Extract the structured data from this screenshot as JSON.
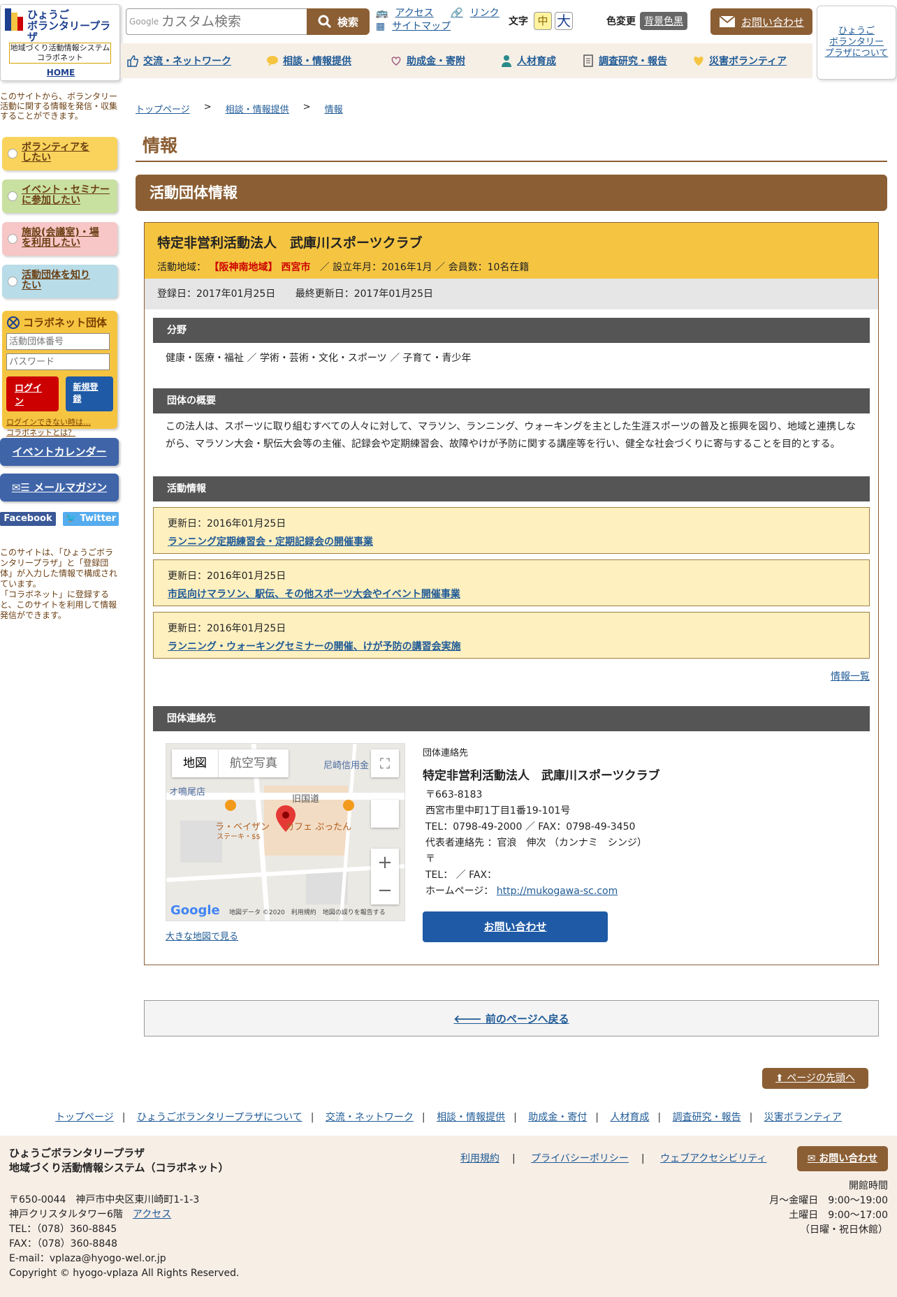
{
  "header": {
    "logo_title": "ひょうご\nボランタリープラザ",
    "logo_sub": "地域づくり活動情報システム\nコラボネット",
    "logo_home": "HOME",
    "search_google": "Google",
    "search_placeholder": "カスタム検索",
    "search_button": "検索",
    "link_access": "アクセス",
    "link_link": "リンク",
    "link_sitemap": "サイトマップ",
    "font_label": "文字",
    "font_mid": "中",
    "font_big": "大",
    "color_label": "色変更",
    "color_button": "背景色黒",
    "contact": "お問い合わせ",
    "about": "ひょうご\nボランタリー\nプラザについて"
  },
  "nav": [
    {
      "label": "交流・ネットワーク"
    },
    {
      "label": "相談・情報提供"
    },
    {
      "label": "助成金・寄附"
    },
    {
      "label": "人材育成"
    },
    {
      "label": "調査研究・報告"
    },
    {
      "label": "災害ボランティア"
    }
  ],
  "sidebar": {
    "intro": "このサイトから、ボランタリー活動に関する情報を発信・収集することができます。",
    "buttons": [
      {
        "label": "ボランティアを\nしたい",
        "color": "#f9d35c"
      },
      {
        "label": "イベント・セミナー\nに参加したい",
        "color": "#c8e0a0"
      },
      {
        "label": "施設(会議室)・場\nを利用したい",
        "color": "#f7c6c6"
      },
      {
        "label": "活動団体を知り\nたい",
        "color": "#b8dce8"
      }
    ],
    "login_title": "コラボネット団体",
    "login_id_placeholder": "活動団体番号",
    "login_pw_placeholder": "パスワード",
    "login_button": "ログイン",
    "register_button": "新規登録",
    "login_help1": "ログインできない時は…",
    "login_help2": "コラボネットとは？",
    "event_calendar": "イベントカレンダー",
    "mail_magazine": "メールマガジン",
    "facebook": "Facebook",
    "twitter": "Twitter",
    "note": "このサイトは、「ひょうごボランタリープラザ」と「登録団体」が入力した情報で構成されています。\n「コラボネット」に登録すると、このサイトを利用して情報発信ができます。"
  },
  "breadcrumb": [
    "トップページ",
    "相談・情報提供",
    "情報"
  ],
  "breadcrumb_sep": ">",
  "page_title": "情報",
  "section_title": "活動団体情報",
  "org": {
    "name": "特定非営利活動法人　武庫川スポーツクラブ",
    "area_label": "活動地域：",
    "area": "【阪神南地域】 西宮市",
    "meta": "／ 設立年月：2016年1月 ／ 会員数：10名在籍",
    "registered": "登録日：2017年01月25日",
    "updated": "最終更新日：2017年01月25日",
    "field_head": "分野",
    "field_text": "健康・医療・福祉 ／ 学術・芸術・文化・スポーツ ／ 子育て・青少年",
    "summary_head": "団体の概要",
    "summary_text": "この法人は、スポーツに取り組むすべての人々に対して、マラソン、ランニング、ウォーキングを主とした生涯スポーツの普及と振興を図り、地域と連携しながら、マラソン大会・駅伝大会等の主催、記録会や定期練習会、故障やけが予防に関する講座等を行い、健全な社会づくりに寄与することを目的とする。",
    "activity_head": "活動情報",
    "activities": [
      {
        "date": "更新日：2016年01月25日",
        "title": "ランニング定期練習会・定期記録会の開催事業"
      },
      {
        "date": "更新日：2016年01月25日",
        "title": "市民向けマラソン、駅伝、その他スポーツ大会やイベント開催事業"
      },
      {
        "date": "更新日：2016年01月25日",
        "title": "ランニング・ウォーキングセミナーの開催、けが予防の講習会実施"
      }
    ],
    "info_list": "情報一覧",
    "contact_head": "団体連絡先"
  },
  "map": {
    "tab_map": "地図",
    "tab_photo": "航空写真",
    "labels": [
      "尼崎信用金",
      "旧国道",
      "オ鳴尾店",
      "ラ・ベイザン",
      "ステーキ・$$",
      "カフェ ぷったん"
    ],
    "credits": "地図データ ©2020　利用規約　地図の誤りを報告する",
    "google": "Google",
    "larger": "大きな地図で見る"
  },
  "contact": {
    "label": "団体連絡先",
    "name": "特定非営利活動法人　武庫川スポーツクラブ",
    "lines": [
      "〒663-8183",
      "西宮市里中町1丁目1番19-101号",
      "TEL：0798-49-2000 ／ FAX：0798-49-3450",
      "代表者連絡先 ：官浪　伸次 （カンナミ　シンジ）",
      "〒",
      "TEL： ／ FAX："
    ],
    "homepage_label": "ホームページ：",
    "homepage_url": "http://mukogawa-sc.com",
    "button": "お問い合わせ"
  },
  "back_button": "前のページへ戻る",
  "to_top": "ページの先頭へ",
  "footer_links": [
    "トップページ",
    "ひょうごボランタリープラザについて",
    "交流・ネットワーク",
    "相談・情報提供",
    "助成金・寄付",
    "人材育成",
    "調査研究・報告",
    "災害ボランティア"
  ],
  "footer": {
    "org": "ひょうごボランタリープラザ\n地域づくり活動情報システム（コラボネット）",
    "addr1": "〒650-0044　神戸市中央区東川崎町1-1-3",
    "addr2": "神戸クリスタルタワー6階",
    "access": "アクセス",
    "tel": "TEL：（078）360-8845",
    "fax": "FAX：（078）360-8848",
    "email": "E-mail：vplaza@hyogo-wel.or.jp",
    "copyright": "Copyright © hyogo-vplaza All Rights Reserved.",
    "legal": [
      "利用規約",
      "プライバシーポリシー",
      "ウェブアクセシビリティ"
    ],
    "contact": "お問い合わせ",
    "hours_title": "開館時間",
    "hours": [
      "月～金曜日　9:00～19:00",
      "土曜日　9:00～17:00",
      "（日曜・祝日休館）"
    ]
  }
}
